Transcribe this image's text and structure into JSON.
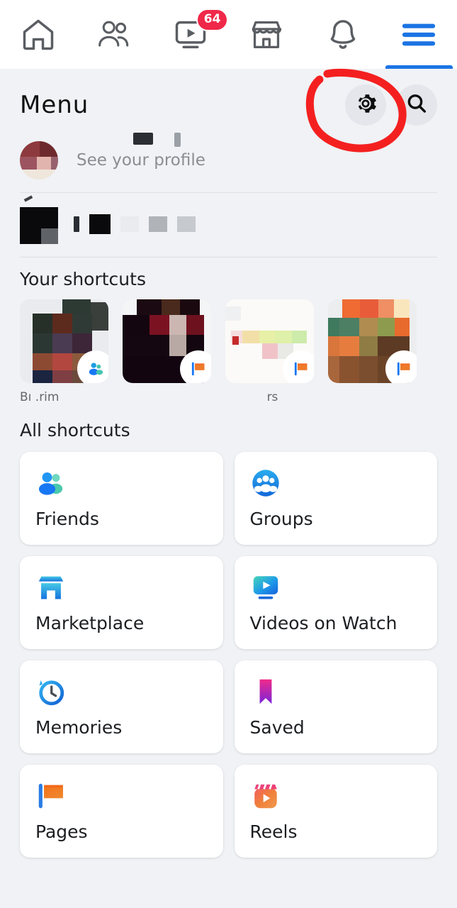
{
  "app": {
    "background_color": "#f0f2f5",
    "accent_color": "#1b74e4",
    "badge_color": "#f02849",
    "annotation_color": "#f42020"
  },
  "topnav": {
    "items": [
      {
        "name": "home-icon",
        "label": "Home",
        "badge": "",
        "active": false
      },
      {
        "name": "friends-icon",
        "label": "Friends",
        "badge": "",
        "active": false
      },
      {
        "name": "watch-icon",
        "label": "Watch",
        "badge": "64",
        "active": false
      },
      {
        "name": "marketplace-icon",
        "label": "Marketplace",
        "badge": "",
        "active": false
      },
      {
        "name": "notifications-bell-icon",
        "label": "Notifications",
        "badge": "",
        "active": false
      },
      {
        "name": "menu-hamburger-icon",
        "label": "Menu",
        "badge": "",
        "active": true
      }
    ],
    "watch_badge": "64"
  },
  "header": {
    "title": "Menu",
    "settings_label": "Settings",
    "search_label": "Search"
  },
  "profile": {
    "see_profile": "See your profile",
    "name": ""
  },
  "sections": {
    "your_shortcuts_title": "Your shortcuts",
    "all_shortcuts_title": "All shortcuts"
  },
  "shortcuts": [
    {
      "label": "Bı             .rim",
      "badge": "groups-badge-icon"
    },
    {
      "label": "",
      "badge": "pages-badge-icon"
    },
    {
      "label": "rs",
      "badge": "pages-badge-icon"
    },
    {
      "label": "",
      "badge": "pages-badge-icon"
    }
  ],
  "all_shortcuts": [
    {
      "label": "Friends",
      "icon": "friends-people-icon"
    },
    {
      "label": "Groups",
      "icon": "groups-circle-icon"
    },
    {
      "label": "Marketplace",
      "icon": "marketplace-storefront-icon"
    },
    {
      "label": "Videos on Watch",
      "icon": "watch-video-icon"
    },
    {
      "label": "Memories",
      "icon": "memories-clock-icon"
    },
    {
      "label": "Saved",
      "icon": "saved-bookmark-icon"
    },
    {
      "label": "Pages",
      "icon": "pages-flag-icon"
    },
    {
      "label": "Reels",
      "icon": "reels-clapper-icon"
    }
  ]
}
